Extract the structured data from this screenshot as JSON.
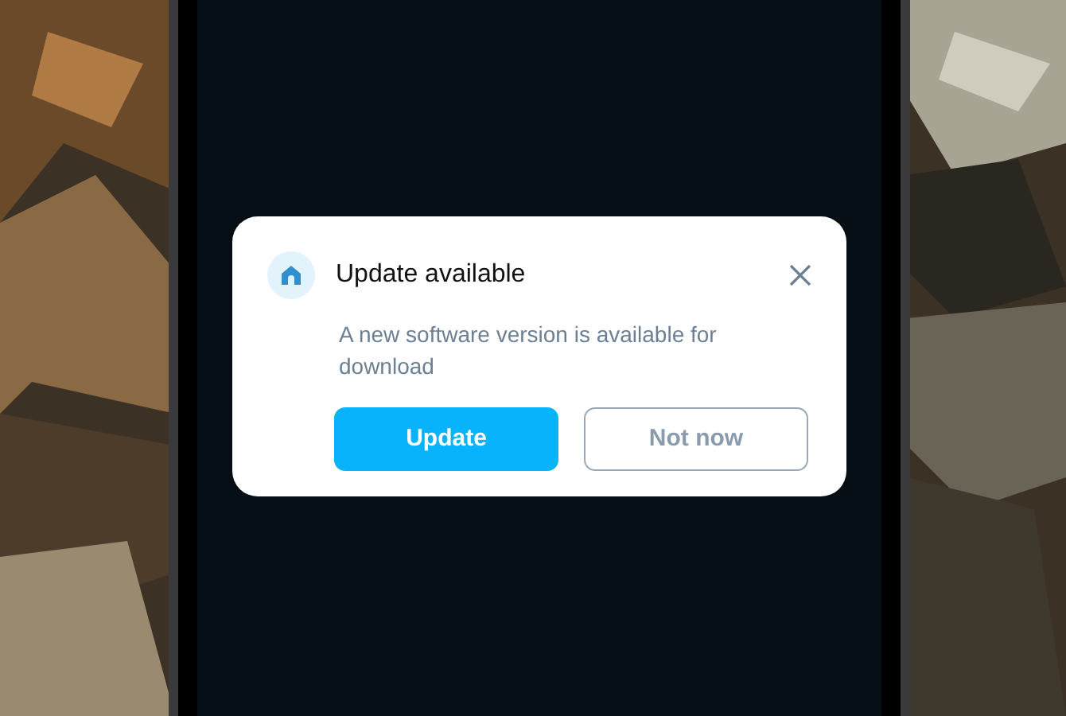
{
  "dialog": {
    "title": "Update available",
    "message": "A new software version is available for download",
    "buttons": [
      {
        "label": "Update",
        "kind": "primary"
      },
      {
        "label": "Not now",
        "kind": "secondary"
      }
    ]
  }
}
